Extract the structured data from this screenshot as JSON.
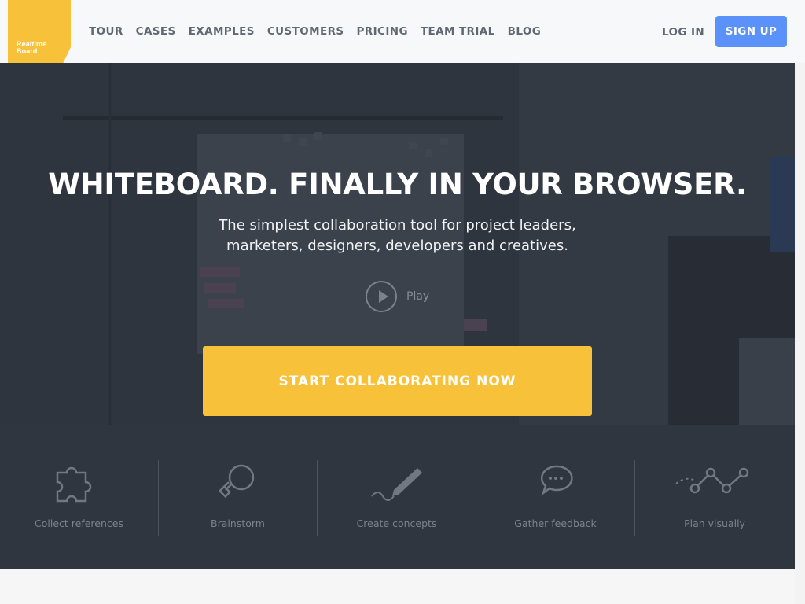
{
  "header": {
    "logo_line1": "Realtime",
    "logo_line2": "Board",
    "nav": [
      "TOUR",
      "CASES",
      "EXAMPLES",
      "CUSTOMERS",
      "PRICING",
      "TEAM TRIAL",
      "BLOG"
    ],
    "login_label": "LOG IN",
    "signup_label": "SIGN UP"
  },
  "hero": {
    "title": "WHITEBOARD. FINALLY IN YOUR BROWSER.",
    "subtitle_line1": "The simplest collaboration tool for project leaders,",
    "subtitle_line2": "marketers, designers, developers and creatives.",
    "play_label": "Play",
    "cta_label": "START COLLABORATING NOW"
  },
  "features": [
    {
      "label": "Collect references",
      "icon": "puzzle-icon"
    },
    {
      "label": "Brainstorm",
      "icon": "lightbulb-icon"
    },
    {
      "label": "Create concepts",
      "icon": "pen-icon"
    },
    {
      "label": "Gather feedback",
      "icon": "speech-bubble-icon"
    },
    {
      "label": "Plan visually",
      "icon": "line-chart-icon"
    }
  ],
  "colors": {
    "brand_yellow": "#f7c23a",
    "signup_blue": "#5a92f9",
    "hero_bg": "#2d333c"
  }
}
